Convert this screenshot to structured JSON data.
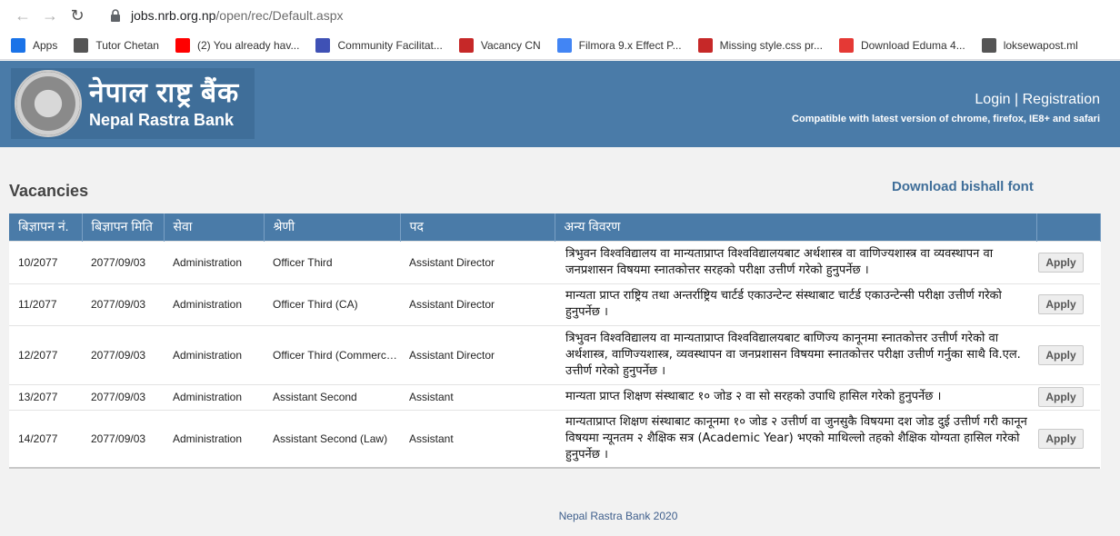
{
  "browser": {
    "url_host": "jobs.nrb.org.np",
    "url_path": "/open/rec/Default.aspx",
    "bookmarks": [
      {
        "label": "Apps",
        "icon": "apps-grid-icon",
        "color": "#1a73e8"
      },
      {
        "label": "Tutor Chetan",
        "icon": "bookmark-page-icon",
        "color": "#555555"
      },
      {
        "label": "(2) You already hav...",
        "icon": "youtube-icon",
        "color": "#ff0000"
      },
      {
        "label": "Community Facilitat...",
        "icon": "shield-icon",
        "color": "#3f51b5"
      },
      {
        "label": "Vacancy CN",
        "icon": "search-globe-icon",
        "color": "#c62828"
      },
      {
        "label": "Filmora 9.x Effect P...",
        "icon": "google-icon",
        "color": "#4285f4"
      },
      {
        "label": "Missing style.css pr...",
        "icon": "wordpress-icon",
        "color": "#c62828"
      },
      {
        "label": "Download Eduma 4...",
        "icon": "g-square-icon",
        "color": "#e53935"
      },
      {
        "label": "loksewapost.ml",
        "icon": "globe-icon",
        "color": "#555555"
      }
    ]
  },
  "header": {
    "logo_np": "नेपाल राष्ट्र बैंक",
    "logo_en": "Nepal Rastra Bank",
    "login": "Login",
    "separator": "|",
    "registration": "Registration",
    "compat": "Compatible with latest version of chrome, firefox, IE8+ and safari"
  },
  "main": {
    "title": "Vacancies",
    "download_font": "Download bishall font",
    "columns": [
      "बिज्ञापन नं.",
      "बिज्ञापन मिति",
      "सेवा",
      "श्रेणी",
      "पद",
      "अन्य विवरण",
      ""
    ],
    "apply_label": "Apply",
    "rows": [
      {
        "no": "10/2077",
        "date": "2077/09/03",
        "service": "Administration",
        "level": "Officer Third",
        "post": "Assistant Director",
        "desc": "त्रिभुवन विश्वविद्यालय वा मान्यताप्राप्त विश्वविद्यालयबाट अर्थशास्त्र वा वाणिज्यशास्त्र वा व्यवस्थापन वा जनप्रशासन विषयमा स्नातकोत्तर सरहको परीक्षा उत्तीर्ण गरेको हुनुपर्नेछ ।"
      },
      {
        "no": "11/2077",
        "date": "2077/09/03",
        "service": "Administration",
        "level": "Officer Third (CA)",
        "post": "Assistant Director",
        "desc": "मान्यता प्राप्त राष्ट्रिय तथा अन्तर्राष्ट्रिय चार्टर्ड एकाउन्टेन्ट संस्थाबाट चार्टर्ड एकाउन्टेन्सी परीक्षा उत्तीर्ण गरेको हुनुपर्नेछ ।"
      },
      {
        "no": "12/2077",
        "date": "2077/09/03",
        "service": "Administration",
        "level": "Officer Third (Commerce Law)",
        "post": "Assistant Director",
        "desc": "त्रिभुवन विश्वविद्यालय वा मान्यताप्राप्त विश्वविद्यालयबाट बाणिज्य कानूनमा स्नातकोत्तर उत्तीर्ण गरेको वा अर्थशास्त्र, वाणिज्यशास्त्र, व्यवस्थापन वा जनप्रशासन विषयमा स्नातकोत्तर परीक्षा उत्तीर्ण गर्नुका साथै वि.एल. उत्तीर्ण गरेको हुनुपर्नेछ ।"
      },
      {
        "no": "13/2077",
        "date": "2077/09/03",
        "service": "Administration",
        "level": "Assistant Second",
        "post": "Assistant",
        "desc": "मान्यता प्राप्त शिक्षण संस्थाबाट १० जोड २ वा सो सरहको उपाधि हासिल गरेको हुनुपर्नेछ ।"
      },
      {
        "no": "14/2077",
        "date": "2077/09/03",
        "service": "Administration",
        "level": "Assistant Second (Law)",
        "post": "Assistant",
        "desc": "मान्यताप्राप्त शिक्षण संस्थाबाट कानूनमा १० जोड २ उत्तीर्ण वा जुनसुकै विषयमा दश जोड दुई उत्तीर्ण गरी कानून विषयमा न्यूनतम २ शैक्षिक सत्र (Academic Year) भएको माथिल्लो तहको शैक्षिक योग्यता हासिल गरेको हुनुपर्नेछ ।"
      }
    ]
  },
  "footer": {
    "text": "Nepal Rastra Bank 2020"
  }
}
